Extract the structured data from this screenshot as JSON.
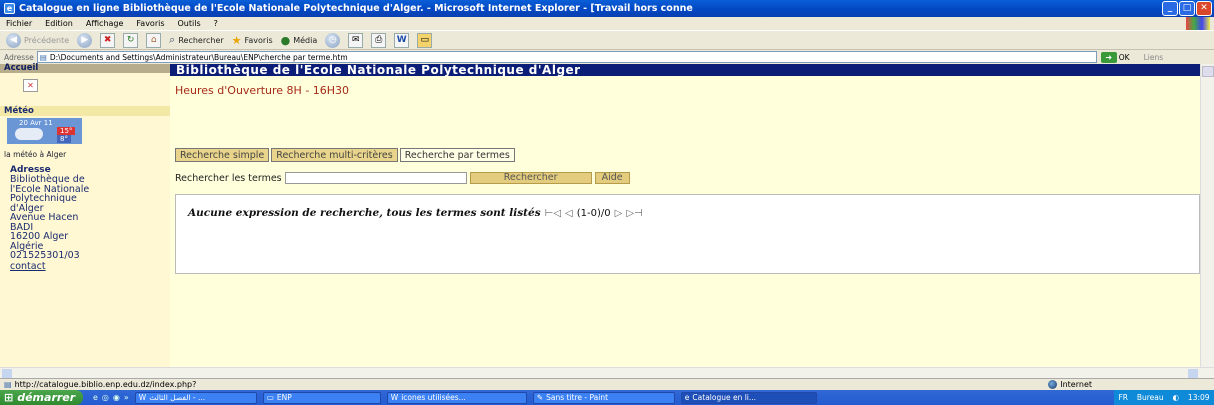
{
  "window": {
    "title": "Catalogue en ligne Bibliothèque de l'Ecole Nationale Polytechnique d'Alger. - Microsoft Internet Explorer - [Travail hors conne",
    "minimize": "_",
    "maximize": "□",
    "close": "✕"
  },
  "menu": [
    "Fichier",
    "Edition",
    "Affichage",
    "Favoris",
    "Outils",
    "?"
  ],
  "toolbar": {
    "back": "Précédente",
    "search": "Rechercher",
    "favorites": "Favoris",
    "media": "Média"
  },
  "address": {
    "label": "Adresse",
    "url": "D:\\Documents and Settings\\Administrateur\\Bureau\\ENP\\cherche par terme.htm",
    "go": "OK",
    "links": "Liens"
  },
  "sidebar": {
    "accueil": "Accueil",
    "meteo_title": "Météo",
    "meteo_date": "20 Avr 11",
    "temp_high": "15°",
    "temp_low": "8°",
    "meteo_link": "la météo à Alger",
    "address_title": "Adresse",
    "address_lines": [
      "Bibliothèque de",
      "l'Ecole Nationale",
      "Polytechnique",
      "d'Alger",
      "Avenue Hacen",
      "BADI",
      "16200 Alger",
      "Algérie",
      "021525301/03"
    ],
    "contact": "contact"
  },
  "main": {
    "banner": "Bibliothèque de l'Ecole Nationale Polytechnique d'Alger",
    "hours": "Heures d'Ouverture 8H - 16H30",
    "tabs": [
      "Recherche simple",
      "Recherche multi-critères",
      "Recherche par termes"
    ],
    "search_label": "Rechercher les termes",
    "search_value": "",
    "search_button": "Rechercher",
    "help_button": "Aide",
    "result_message": "Aucune expression de recherche, tous les termes sont listés",
    "nav_first": "⊢◁",
    "nav_prev": "◁",
    "counter": "(1-0)/0",
    "nav_next": "▷",
    "nav_last": "▷⊣"
  },
  "status": {
    "url": "http://catalogue.biblio.enp.edu.dz/index.php?",
    "zone": "Internet"
  },
  "taskbar": {
    "start": "démarrer",
    "tasks": [
      "الفصل الثالث - ...",
      "ENP",
      "icones utilisées...",
      "Sans titre - Paint",
      "Catalogue en li..."
    ],
    "lang": "FR",
    "bureau": "Bureau",
    "clock": "13:09"
  }
}
